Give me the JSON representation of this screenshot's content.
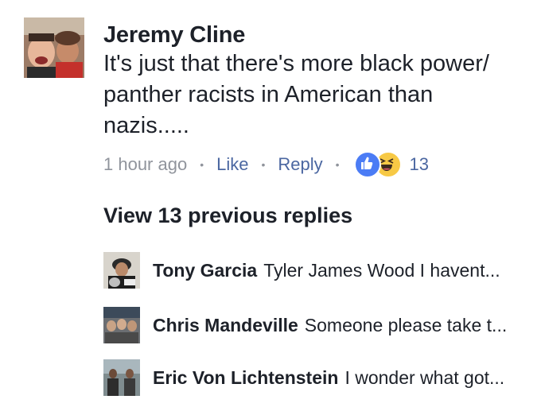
{
  "comment": {
    "author": "Jeremy Cline",
    "text": "It's just that there's more black power/ panther racists in American than nazis.....",
    "time": "1 hour ago",
    "like_label": "Like",
    "reply_label": "Reply",
    "separator": "•",
    "reaction_count": "13",
    "reaction_icons": [
      "like-icon",
      "haha-icon"
    ]
  },
  "view_previous": "View 13 previous replies",
  "replies": [
    {
      "author": "Tony Garcia",
      "snippet": "Tyler James Wood I havent..."
    },
    {
      "author": "Chris Mandeville",
      "snippet": "Someone please take t..."
    },
    {
      "author": "Eric Von Lichtenstein",
      "snippet": "I wonder what got..."
    }
  ],
  "colors": {
    "text": "#1d2129",
    "meta_gray": "#90949c",
    "link_blue": "#4b67a1",
    "like_blue": "#4b7cf5",
    "haha_yellow": "#f7c945"
  }
}
